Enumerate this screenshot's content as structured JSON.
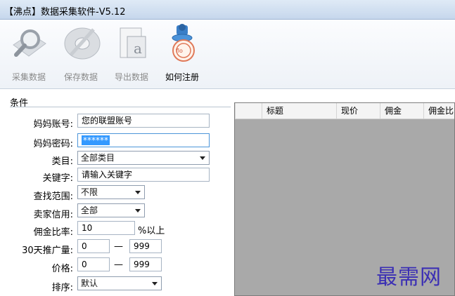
{
  "window": {
    "title": "【沸点】数据采集软件-V5.12"
  },
  "toolbar": {
    "items": [
      {
        "label": "采集数据",
        "icon": "magnifier-icon",
        "enabled": false
      },
      {
        "label": "保存数据",
        "icon": "save-disk-icon",
        "enabled": false
      },
      {
        "label": "导出数据",
        "icon": "export-document-icon",
        "enabled": false
      },
      {
        "label": "如何注册",
        "icon": "register-stamp-icon",
        "enabled": true
      }
    ]
  },
  "conditions": {
    "section_label": "条件",
    "account": {
      "label": "妈妈账号:",
      "value": "您的联盟账号"
    },
    "password": {
      "label": "妈妈密码:",
      "value": "******"
    },
    "category": {
      "label": "类目:",
      "value": "全部类目"
    },
    "keyword": {
      "label": "关键字:",
      "value": "请输入关键字"
    },
    "scope": {
      "label": "查找范围:",
      "value": "不限"
    },
    "credit": {
      "label": "卖家信用:",
      "value": "全部"
    },
    "commission": {
      "label": "佣金比率:",
      "value": "10",
      "suffix": "%以上"
    },
    "promo30": {
      "label": "30天推广量:",
      "min": "0",
      "max": "999",
      "dash": "—"
    },
    "price": {
      "label": "价格:",
      "min": "0",
      "max": "999",
      "dash": "—"
    },
    "sort": {
      "label": "排序:",
      "value": "默认"
    }
  },
  "grid": {
    "columns": [
      "标题",
      "现价",
      "佣金",
      "佣金比"
    ]
  },
  "watermark": "最需网",
  "colors": {
    "accent": "#3399ff",
    "grid_bg": "#a9a9a9",
    "watermark": "#3b2fb4"
  }
}
